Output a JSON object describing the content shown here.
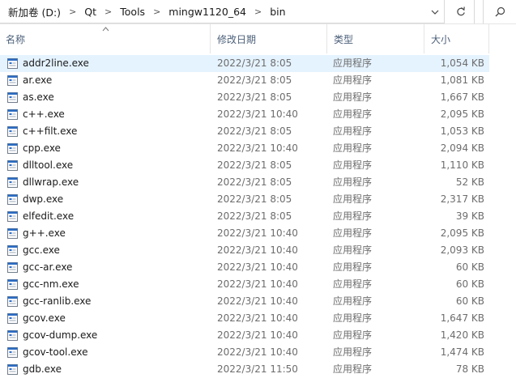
{
  "breadcrumb": [
    "新加卷 (D:)",
    "Qt",
    "Tools",
    "mingw1120_64",
    "bin"
  ],
  "icons": {
    "dropdown": "chevron-down-icon",
    "refresh": "refresh-icon",
    "search": "search-icon",
    "sort": "sort-up-icon",
    "file": "exe-file-icon"
  },
  "columns": {
    "name": "名称",
    "date": "修改日期",
    "type": "类型",
    "size": "大小"
  },
  "colors": {
    "selected_row": "#e5f3ff",
    "header_text": "#4c607a",
    "icon_blue": "#2b6cc4"
  },
  "files": [
    {
      "name": "addr2line.exe",
      "date": "2022/3/21 8:05",
      "type": "应用程序",
      "size": "1,054 KB",
      "selected": true
    },
    {
      "name": "ar.exe",
      "date": "2022/3/21 8:05",
      "type": "应用程序",
      "size": "1,081 KB"
    },
    {
      "name": "as.exe",
      "date": "2022/3/21 8:05",
      "type": "应用程序",
      "size": "1,667 KB"
    },
    {
      "name": "c++.exe",
      "date": "2022/3/21 10:40",
      "type": "应用程序",
      "size": "2,095 KB"
    },
    {
      "name": "c++filt.exe",
      "date": "2022/3/21 8:05",
      "type": "应用程序",
      "size": "1,053 KB"
    },
    {
      "name": "cpp.exe",
      "date": "2022/3/21 10:40",
      "type": "应用程序",
      "size": "2,094 KB"
    },
    {
      "name": "dlltool.exe",
      "date": "2022/3/21 8:05",
      "type": "应用程序",
      "size": "1,110 KB"
    },
    {
      "name": "dllwrap.exe",
      "date": "2022/3/21 8:05",
      "type": "应用程序",
      "size": "52 KB"
    },
    {
      "name": "dwp.exe",
      "date": "2022/3/21 8:05",
      "type": "应用程序",
      "size": "2,317 KB"
    },
    {
      "name": "elfedit.exe",
      "date": "2022/3/21 8:05",
      "type": "应用程序",
      "size": "39 KB"
    },
    {
      "name": "g++.exe",
      "date": "2022/3/21 10:40",
      "type": "应用程序",
      "size": "2,095 KB"
    },
    {
      "name": "gcc.exe",
      "date": "2022/3/21 10:40",
      "type": "应用程序",
      "size": "2,093 KB"
    },
    {
      "name": "gcc-ar.exe",
      "date": "2022/3/21 10:40",
      "type": "应用程序",
      "size": "60 KB"
    },
    {
      "name": "gcc-nm.exe",
      "date": "2022/3/21 10:40",
      "type": "应用程序",
      "size": "60 KB"
    },
    {
      "name": "gcc-ranlib.exe",
      "date": "2022/3/21 10:40",
      "type": "应用程序",
      "size": "60 KB"
    },
    {
      "name": "gcov.exe",
      "date": "2022/3/21 10:40",
      "type": "应用程序",
      "size": "1,647 KB"
    },
    {
      "name": "gcov-dump.exe",
      "date": "2022/3/21 10:40",
      "type": "应用程序",
      "size": "1,420 KB"
    },
    {
      "name": "gcov-tool.exe",
      "date": "2022/3/21 10:40",
      "type": "应用程序",
      "size": "1,474 KB"
    },
    {
      "name": "gdb.exe",
      "date": "2022/3/21 11:50",
      "type": "应用程序",
      "size": "78 KB"
    }
  ]
}
